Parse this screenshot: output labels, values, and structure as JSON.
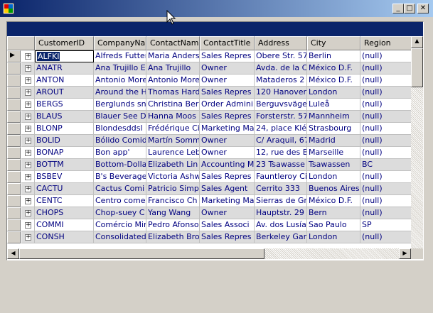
{
  "window": {
    "minimize_glyph": "_",
    "maximize_glyph": "□",
    "close_glyph": "✕"
  },
  "columns": [
    "CustomerID",
    "CompanyNa",
    "ContactName",
    "ContactTitle",
    "Address",
    "City",
    "Region"
  ],
  "current_row_indicator": "▶",
  "expand_glyph": "+",
  "rows": [
    {
      "id": "ALFKI",
      "company": "Alfreds Futter",
      "contact": "Maria Anders",
      "title": "Sales Repres",
      "address": "Obere Str. 57",
      "city": "Berlin",
      "region": "(null)"
    },
    {
      "id": "ANATR",
      "company": "Ana Trujillo E",
      "contact": "Ana Trujillo",
      "title": "Owner",
      "address": "Avda. de la C",
      "city": "México D.F.",
      "region": "(null)"
    },
    {
      "id": "ANTON",
      "company": "Antonio More",
      "contact": "Antonio More",
      "title": "Owner",
      "address": "Mataderos 2",
      "city": "México D.F.",
      "region": "(null)"
    },
    {
      "id": "AROUT",
      "company": "Around the H",
      "contact": "Thomas Hard",
      "title": "Sales Repres",
      "address": "120 Hanover",
      "city": "London",
      "region": "(null)"
    },
    {
      "id": "BERGS",
      "company": "Berglunds sn",
      "contact": "Christina Ber",
      "title": "Order Admini",
      "address": "Berguvsväge",
      "city": "Luleå",
      "region": "(null)"
    },
    {
      "id": "BLAUS",
      "company": "Blauer See D",
      "contact": "Hanna Moos",
      "title": "Sales Repres",
      "address": "Forsterstr. 57",
      "city": "Mannheim",
      "region": "(null)"
    },
    {
      "id": "BLONP",
      "company": "Blondesddsl",
      "contact": "Frédérique Ci",
      "title": "Marketing Ma",
      "address": "24, place Klé",
      "city": "Strasbourg",
      "region": "(null)"
    },
    {
      "id": "BOLID",
      "company": "Bólido Comid",
      "contact": "Martín Somm",
      "title": "Owner",
      "address": "C/ Araquil, 67",
      "city": "Madrid",
      "region": "(null)"
    },
    {
      "id": "BONAP",
      "company": "Bon app'",
      "contact": "Laurence Leb",
      "title": "Owner",
      "address": "12, rue des B",
      "city": "Marseille",
      "region": "(null)"
    },
    {
      "id": "BOTTM",
      "company": "Bottom-Dollar",
      "contact": "Elizabeth Lin",
      "title": "Accounting M",
      "address": "23 Tsawasse",
      "city": "Tsawassen",
      "region": "BC"
    },
    {
      "id": "BSBEV",
      "company": "B's Beverage",
      "contact": "Victoria Ashw",
      "title": "Sales Repres",
      "address": "Fauntleroy Ci",
      "city": "London",
      "region": "(null)"
    },
    {
      "id": "CACTU",
      "company": "Cactus Comi",
      "contact": "Patricio Simp",
      "title": "Sales Agent",
      "address": "Cerrito 333",
      "city": "Buenos Aires",
      "region": "(null)"
    },
    {
      "id": "CENTC",
      "company": "Centro comer",
      "contact": "Francisco Ch",
      "title": "Marketing Ma",
      "address": "Sierras de Gr",
      "city": "México D.F.",
      "region": "(null)"
    },
    {
      "id": "CHOPS",
      "company": "Chop-suey C",
      "contact": "Yang Wang",
      "title": "Owner",
      "address": "Hauptstr. 29",
      "city": "Bern",
      "region": "(null)"
    },
    {
      "id": "COMMI",
      "company": "Comércio Min",
      "contact": "Pedro Afonso",
      "title": "Sales Associ",
      "address": "Av. dos Lusía",
      "city": "Sao Paulo",
      "region": "SP"
    },
    {
      "id": "CONSH",
      "company": "Consolidated",
      "contact": "Elizabeth Bro",
      "title": "Sales Repres",
      "address": "Berkeley Gar",
      "city": "London",
      "region": "(null)"
    }
  ],
  "scrollbar": {
    "up": "▲",
    "down": "▼",
    "left": "◀",
    "right": "▶"
  },
  "colors": {
    "titlebar": "#0a246a",
    "grid_caption": "#0a246a",
    "row_alt": "#dcdcdc",
    "cell_text": "#000080",
    "selected": "#0a246a"
  }
}
